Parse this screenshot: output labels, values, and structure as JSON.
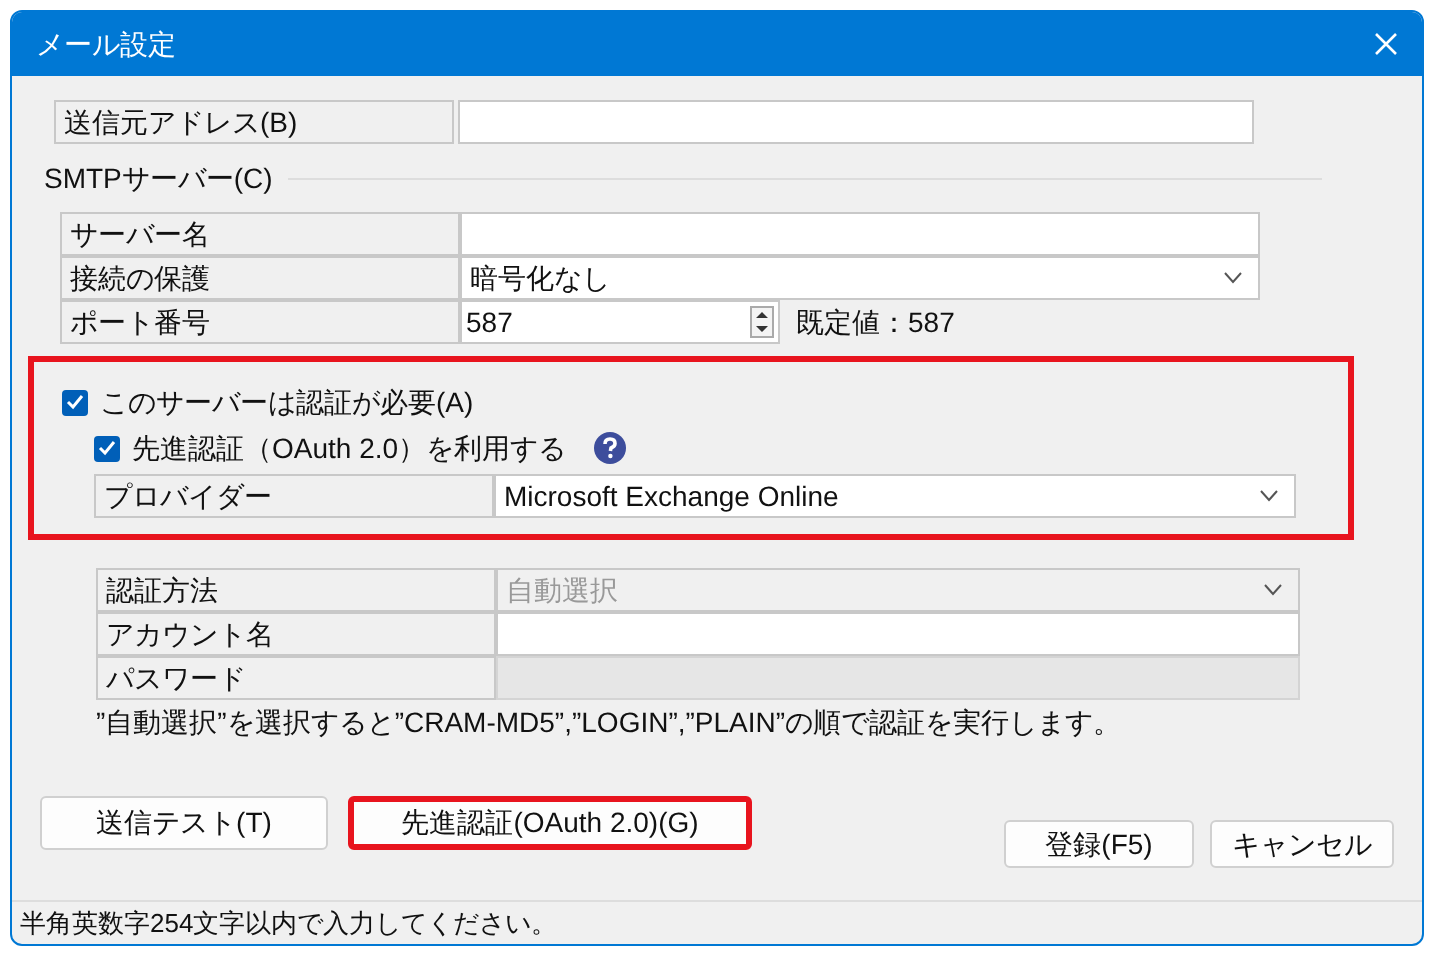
{
  "window": {
    "title": "メール設定"
  },
  "sender": {
    "label": "送信元アドレス(B)"
  },
  "smtp": {
    "heading": "SMTPサーバー(C)",
    "rows": [
      {
        "kind": "text",
        "label": "サーバー名"
      },
      {
        "kind": "select",
        "label": "接続の保護",
        "value": "暗号化なし"
      },
      {
        "kind": "spin",
        "label": "ポート番号",
        "value": "587",
        "note": "既定値：587"
      }
    ]
  },
  "auth": {
    "highlighted": true,
    "required": {
      "label": "このサーバーは認証が必要(A)",
      "checked": true
    },
    "oauth": {
      "label": "先進認証（OAuth 2.0）を利用する",
      "checked": true
    },
    "provider": {
      "label": "プロバイダー",
      "value": "Microsoft Exchange Online"
    }
  },
  "auth_fields": [
    {
      "kind": "select",
      "label": "認証方法",
      "value": "自動選択",
      "disabled": true
    },
    {
      "kind": "text",
      "label": "アカウント名",
      "disabled": false
    },
    {
      "kind": "text",
      "label": "パスワード",
      "disabled": true
    }
  ],
  "note": "”自動選択”を選択すると”CRAM-MD5”,”LOGIN”,”PLAIN”の順で認証を実行します。",
  "buttons": [
    {
      "label": "送信テスト(T)",
      "highlighted": false
    },
    {
      "label": "先進認証(OAuth 2.0)(G)",
      "highlighted": true
    }
  ],
  "dialog_buttons": [
    "登録(F5)",
    "キャンセル"
  ],
  "status_bar": "半角英数字254文字以内で入力してください。"
}
